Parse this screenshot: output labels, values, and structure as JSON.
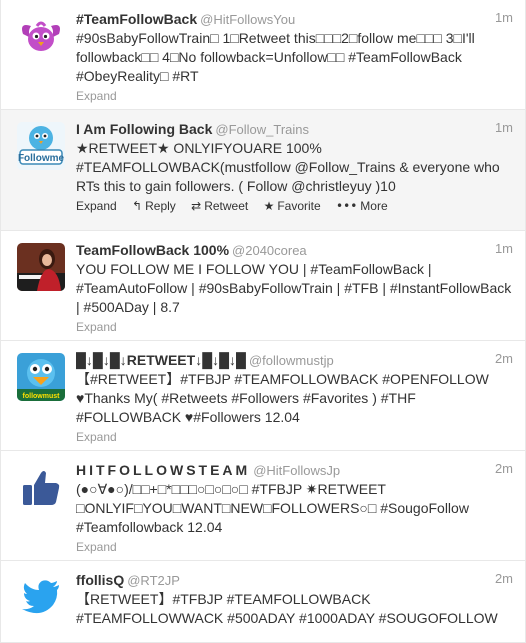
{
  "tweets": [
    {
      "fullname": "#TeamFollowBack",
      "username": "@HitFollowsYou",
      "time": "1m",
      "text": "#90sBabyFollowTrain□ 1□Retweet this□□□2□follow me□□□ 3□I'll followback□□ 4□No followback=Unfollow□□ #TeamFollowBack #ObeyReality□ #RT",
      "expand": "Expand",
      "avatar": "purple-bird-icon"
    },
    {
      "fullname": "I Am Following Back",
      "username": "@Follow_Trains",
      "time": "1m",
      "text": "★RETWEET★ ONLYIFYOUARE 100% #TEAMFOLLOWBACK(mustfollow @Follow_Trains & everyone who RTs this to gain followers. ( Follow @christleyuy )10",
      "expand": "Expand",
      "avatar": "followme-bird-icon",
      "actions": {
        "reply": "Reply",
        "retweet": "Retweet",
        "favorite": "Favorite",
        "more": "More"
      }
    },
    {
      "fullname": "TeamFollowBack 100%",
      "username": "@2040corea",
      "time": "1m",
      "text": "YOU FOLLOW ME I FOLLOW YOU | #TeamFollowBack | #TeamAutoFollow | #90sBabyFollowTrain | #TFB | #InstantFollowBack | #500ADay | 8.7",
      "expand": "Expand",
      "avatar": "user-photo"
    },
    {
      "fullname": "█↓█↓█↓RETWEET↓█↓█↓█",
      "username": "@followmustjp",
      "time": "2m",
      "text": "【#RETWEET】#TFBJP #TEAMFOLLOWBACK #OPENFOLLOW ♥Thanks My( #Retweets #Followers #Favorites ) #THF #FOLLOWBACK ♥#Followers 12.04",
      "expand": "Expand",
      "avatar": "cartoon-bird-icon"
    },
    {
      "fullname": "HITFOLLOWSTEAM",
      "username": "@HitFollowsJp",
      "time": "2m",
      "text": "(●○∀●○)/□□+□*□□□○□○□○□ #TFBJP ✷RETWEET □ONLYIF□YOU□WANT□NEW□FOLLOWERS○□ #SougoFollow #Teamfollowback 12.04",
      "expand": "Expand",
      "avatar": "thumbs-up-icon"
    },
    {
      "fullname": "ffollisQ",
      "username": "@RT2JP",
      "time": "2m",
      "text": "【RETWEET】#TFBJP #TEAMFOLLOWBACK #TEAMFOLLOWWACK #500ADAY #1000ADAY #SOUGOFOLLOW",
      "expand": "",
      "avatar": "twitter-bird-icon"
    }
  ]
}
